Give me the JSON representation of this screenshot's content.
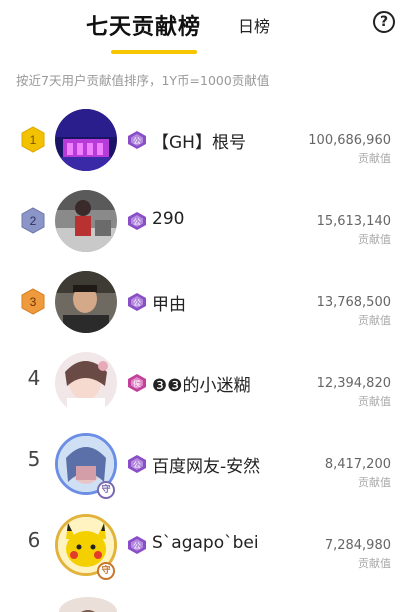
{
  "header": {
    "tab_weekly": "七天贡献榜",
    "tab_daily": "日榜",
    "help_glyph": "?"
  },
  "subtitle": "按近7天用户贡献值排序，1Y币=1000贡献值",
  "score_label": "贡献值",
  "colors": {
    "accent": "#f7c600",
    "gold": "#f2c200",
    "silver": "#8c95c7",
    "bronze": "#f09a3e",
    "level_purple": "#8a4fc7"
  },
  "rows": [
    {
      "rank": "1",
      "name": "【GH】根号",
      "score": "100,686,960",
      "badge": "gold"
    },
    {
      "rank": "2",
      "name": "290",
      "score": "15,613,140",
      "badge": "silver"
    },
    {
      "rank": "3",
      "name": "甲由",
      "score": "13,768,500",
      "badge": "bronze"
    },
    {
      "rank": "4",
      "name": "❸❸的小迷糊",
      "score": "12,394,820",
      "badge": "none"
    },
    {
      "rank": "5",
      "name": "百度网友-安然",
      "score": "8,417,200",
      "badge": "none"
    },
    {
      "rank": "6",
      "name": "S`agapo`bei",
      "score": "7,284,980",
      "badge": "none"
    }
  ]
}
